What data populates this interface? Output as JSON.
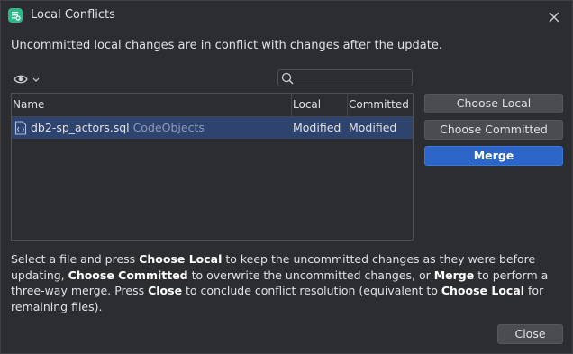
{
  "window": {
    "title": "Local Conflicts"
  },
  "message": "Uncommitted local changes are in conflict with changes after the update.",
  "search": {
    "placeholder": "",
    "value": ""
  },
  "table": {
    "columns": [
      "Name",
      "Local",
      "Committed"
    ],
    "rows": [
      {
        "file": "db2-sp_actors.sql",
        "location": "CodeObjects",
        "local": "Modified",
        "committed": "Modified",
        "selected": true
      }
    ]
  },
  "actions": {
    "choose_local": "Choose Local",
    "choose_committed": "Choose Committed",
    "merge": "Merge",
    "close": "Close"
  },
  "help": {
    "t1": "Select a file and press ",
    "b1": "Choose Local",
    "t2": " to keep the uncommitted changes as they were before updating, ",
    "b2": "Choose Committed",
    "t3": " to overwrite the uncommitted changes, or ",
    "b3": "Merge",
    "t4": " to perform a three-way merge. Press ",
    "b4": "Close",
    "t5": " to conclude conflict resolution (equivalent to ",
    "b5": "Choose Local",
    "t6": " for remaining files)."
  },
  "colors": {
    "background": "#2b2d30",
    "selection": "#2e436e",
    "primary_button": "#2c65c8",
    "app_icon": "#2fb98b"
  },
  "icons": {
    "app": "vcs-app-icon",
    "close": "close-icon",
    "view_options": "eye-icon",
    "search": "search-icon",
    "file": "sql-file-icon"
  }
}
